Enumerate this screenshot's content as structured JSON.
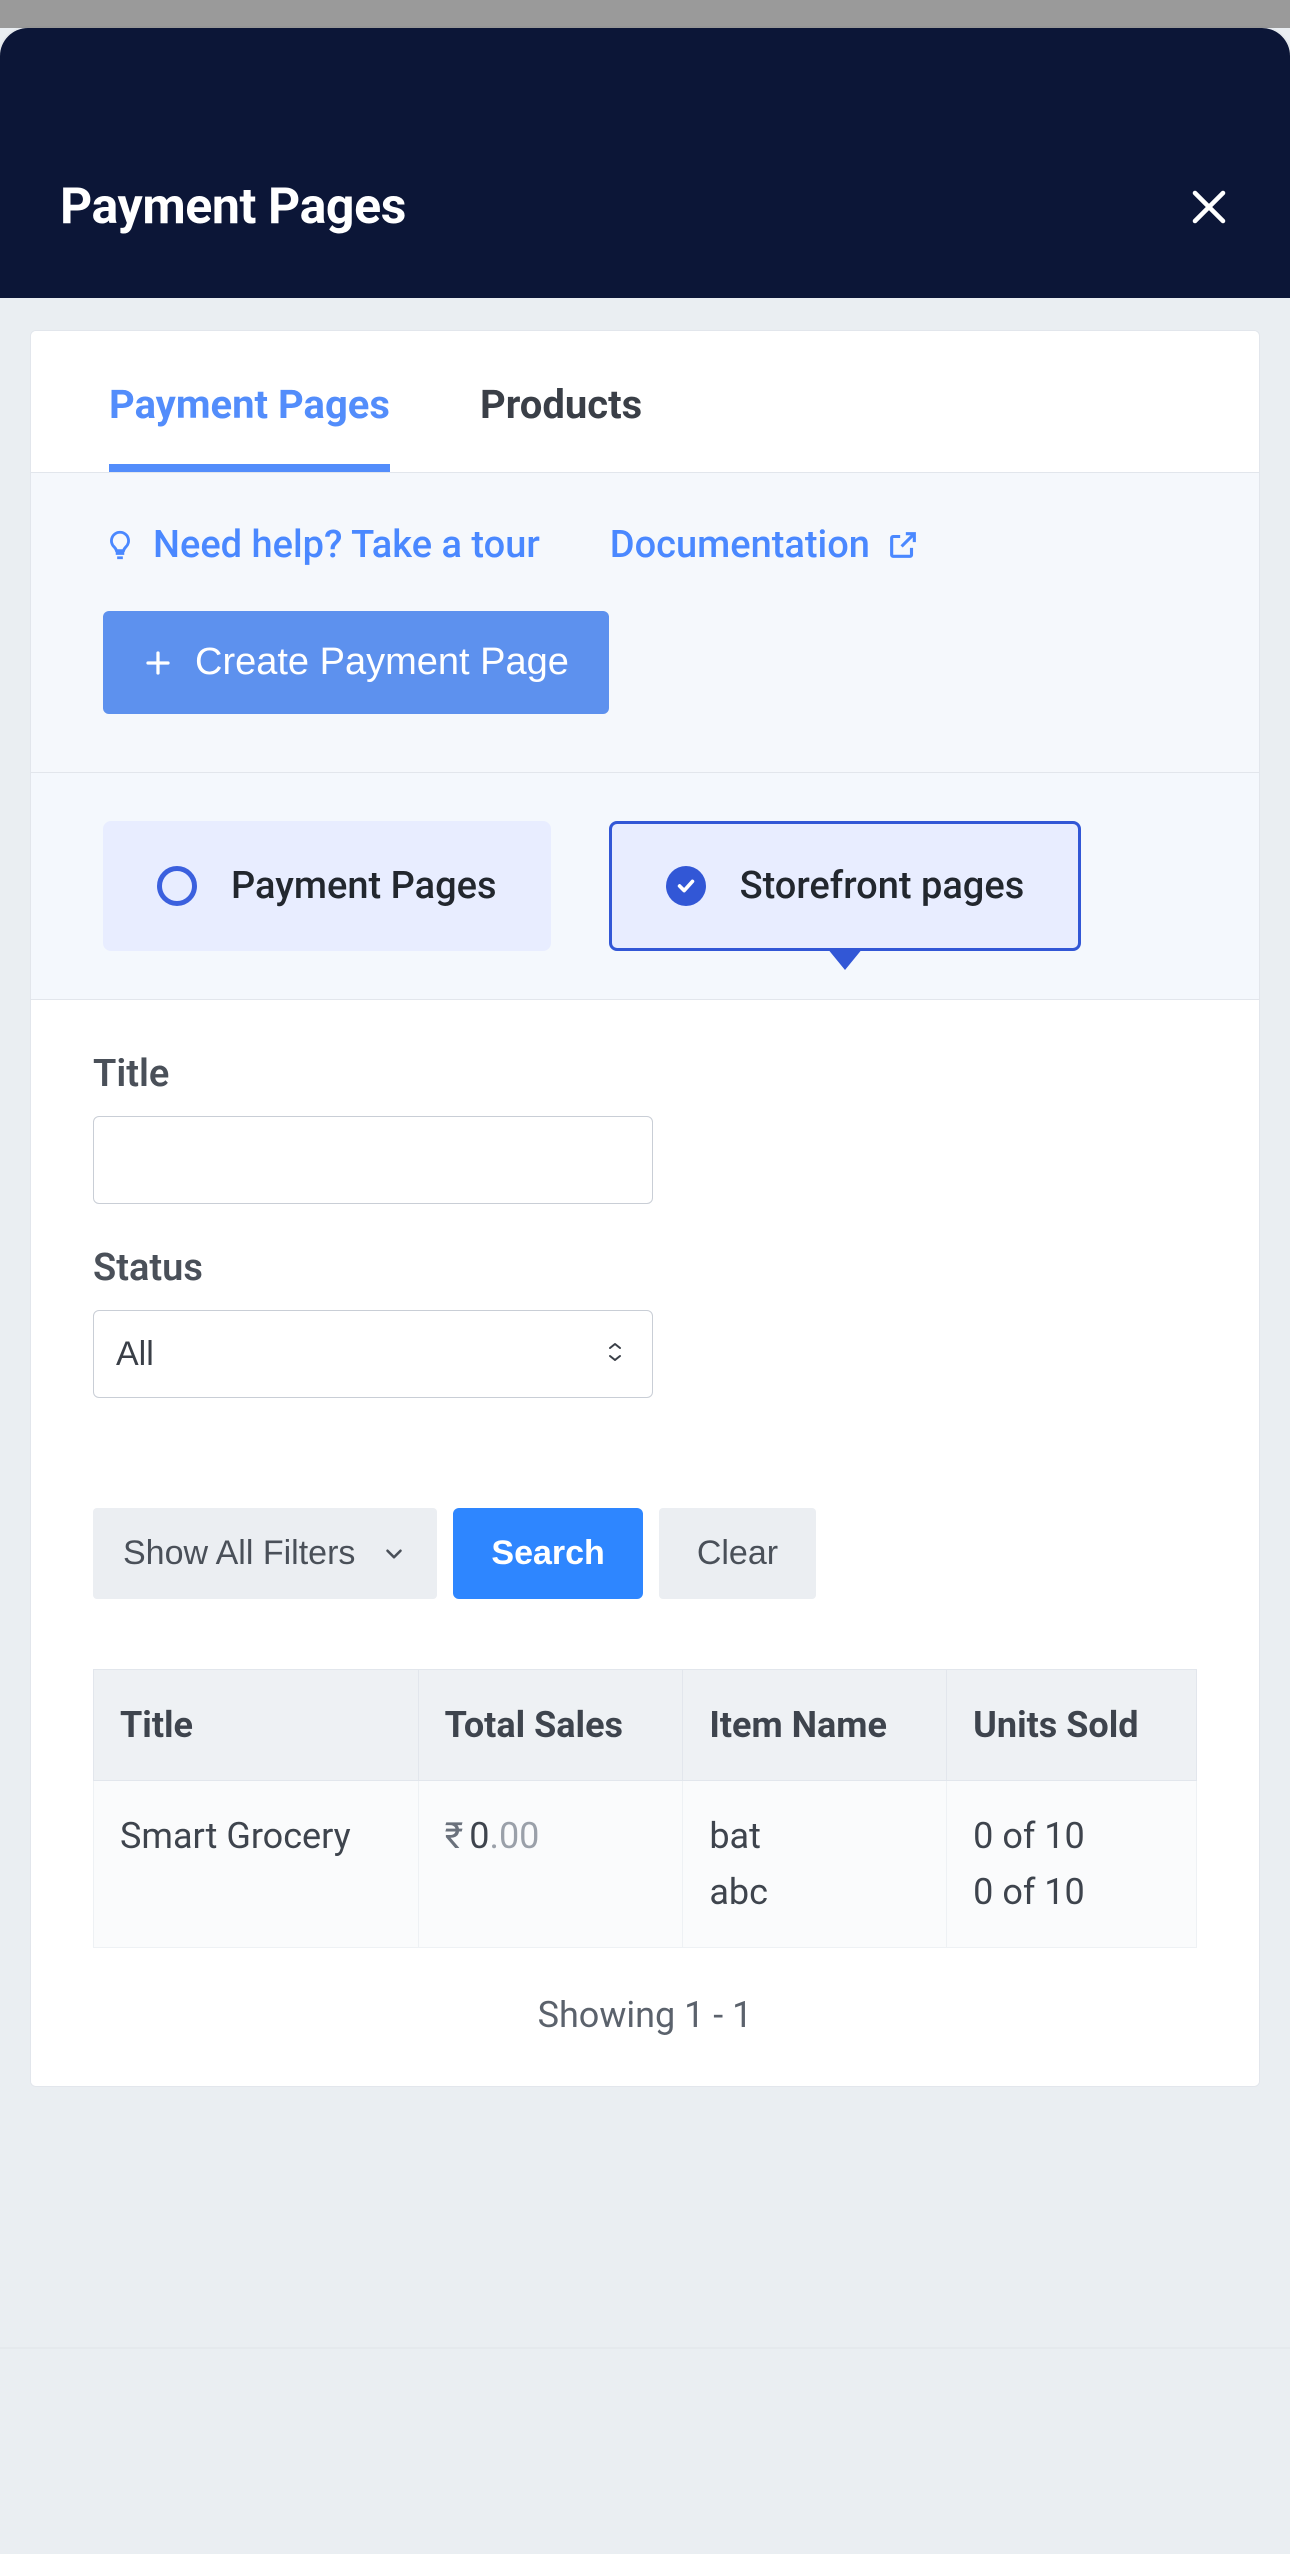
{
  "modal": {
    "title": "Payment Pages"
  },
  "tabs": {
    "items": [
      {
        "label": "Payment Pages",
        "active": true
      },
      {
        "label": "Products",
        "active": false
      }
    ]
  },
  "toolbar": {
    "help_label": "Need help? Take a tour",
    "docs_label": "Documentation",
    "create_label": "Create Payment Page"
  },
  "viewToggle": {
    "items": [
      {
        "label": "Payment Pages",
        "selected": false
      },
      {
        "label": "Storefront pages",
        "selected": true
      }
    ]
  },
  "filters": {
    "title_label": "Title",
    "title_value": "",
    "status_label": "Status",
    "status_value": "All",
    "show_all_label": "Show All Filters",
    "search_label": "Search",
    "clear_label": "Clear"
  },
  "table": {
    "columns": [
      "Title",
      "Total Sales",
      "Item Name",
      "Units Sold"
    ],
    "rows": [
      {
        "title": "Smart Grocery",
        "total_sales": {
          "currency": "₹",
          "major": "0",
          "minor": ".00"
        },
        "items": [
          "bat",
          "abc"
        ],
        "units_sold": [
          "0 of 10",
          "0 of 10"
        ]
      }
    ]
  },
  "pager": {
    "text": "Showing 1 - 1"
  }
}
